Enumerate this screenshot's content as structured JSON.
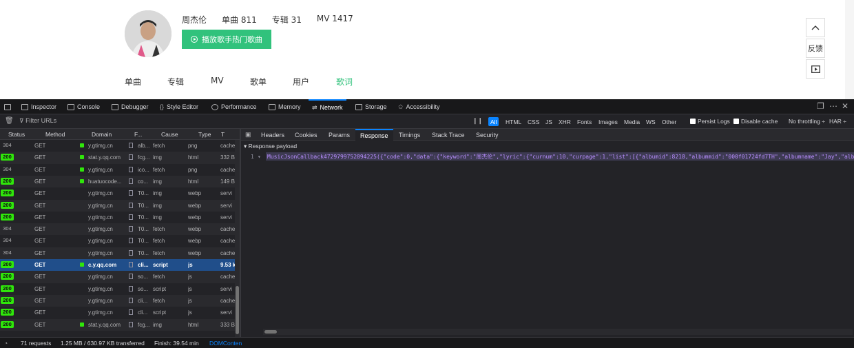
{
  "page": {
    "artist_name": "周杰伦",
    "stats": [
      "单曲 811",
      "专辑 31",
      "MV 1417"
    ],
    "play_button": "播放歌手热门歌曲",
    "tabs": [
      "单曲",
      "专辑",
      "MV",
      "歌单",
      "用户",
      "歌词"
    ],
    "active_tab": "歌词",
    "feedback_label": "反馈",
    "accent_color": "#31c27c"
  },
  "devtools": {
    "tabs": [
      "Inspector",
      "Console",
      "Debugger",
      "Style Editor",
      "Performance",
      "Memory",
      "Network",
      "Storage",
      "Accessibility"
    ],
    "active_tab": "Network",
    "filter_placeholder": "Filter URLs",
    "type_filters": [
      "All",
      "HTML",
      "CSS",
      "JS",
      "XHR",
      "Fonts",
      "Images",
      "Media",
      "WS",
      "Other"
    ],
    "persist_logs": "Persist Logs",
    "disable_cache": "Disable cache",
    "throttling": "No throttling ÷",
    "har": "HAR ÷",
    "columns": [
      "Status",
      "Method",
      "Domain",
      "F...",
      "Cause",
      "Type",
      "T"
    ],
    "requests": [
      {
        "status": "304",
        "method": "GET",
        "domain": "y.gtimg.cn",
        "file": "alb...",
        "cause": "fetch",
        "type": "png",
        "transferred": "cache"
      },
      {
        "status": "200",
        "method": "GET",
        "domain": "stat.y.qq.com",
        "file": "fcg...",
        "cause": "img",
        "type": "html",
        "transferred": "332 B"
      },
      {
        "status": "304",
        "method": "GET",
        "domain": "y.gtimg.cn",
        "file": "ico...",
        "cause": "fetch",
        "type": "png",
        "transferred": "cache"
      },
      {
        "status": "200",
        "method": "GET",
        "domain": "huatuocode...",
        "file": "co...",
        "cause": "img",
        "type": "html",
        "transferred": "149 B"
      },
      {
        "status": "200",
        "method": "GET",
        "domain": "y.gtimg.cn",
        "file": "T0...",
        "cause": "img",
        "type": "webp",
        "transferred": "servi"
      },
      {
        "status": "200",
        "method": "GET",
        "domain": "y.gtimg.cn",
        "file": "T0...",
        "cause": "img",
        "type": "webp",
        "transferred": "servi"
      },
      {
        "status": "200",
        "method": "GET",
        "domain": "y.gtimg.cn",
        "file": "T0...",
        "cause": "img",
        "type": "webp",
        "transferred": "servi"
      },
      {
        "status": "304",
        "method": "GET",
        "domain": "y.gtimg.cn",
        "file": "T0...",
        "cause": "fetch",
        "type": "webp",
        "transferred": "cache"
      },
      {
        "status": "304",
        "method": "GET",
        "domain": "y.gtimg.cn",
        "file": "T0...",
        "cause": "fetch",
        "type": "webp",
        "transferred": "cache"
      },
      {
        "status": "304",
        "method": "GET",
        "domain": "y.gtimg.cn",
        "file": "T0...",
        "cause": "fetch",
        "type": "webp",
        "transferred": "cache"
      },
      {
        "status": "200",
        "method": "GET",
        "domain": "c.y.qq.com",
        "file": "cli...",
        "cause": "script",
        "type": "js",
        "transferred": "9.53 k"
      },
      {
        "status": "200",
        "method": "GET",
        "domain": "y.gtimg.cn",
        "file": "so...",
        "cause": "fetch",
        "type": "js",
        "transferred": "cache"
      },
      {
        "status": "200",
        "method": "GET",
        "domain": "y.gtimg.cn",
        "file": "so...",
        "cause": "script",
        "type": "js",
        "transferred": "servi"
      },
      {
        "status": "200",
        "method": "GET",
        "domain": "y.gtimg.cn",
        "file": "cli...",
        "cause": "fetch",
        "type": "js",
        "transferred": "cache"
      },
      {
        "status": "200",
        "method": "GET",
        "domain": "y.gtimg.cn",
        "file": "cli...",
        "cause": "script",
        "type": "js",
        "transferred": "servi"
      },
      {
        "status": "200",
        "method": "GET",
        "domain": "stat.y.qq.com",
        "file": "fcg...",
        "cause": "img",
        "type": "html",
        "transferred": "333 B"
      }
    ],
    "selected_request": 10,
    "response_tabs": [
      "Headers",
      "Cookies",
      "Params",
      "Response",
      "Timings",
      "Stack Trace",
      "Security"
    ],
    "active_response_tab": "Response",
    "payload_label": "Response payload",
    "line_number": "1",
    "response_code": "MusicJsonCallback4729799752894225({\"code\":0,\"data\":{\"keyword\":\"周杰伦\",\"lyric\":{\"curnum\":10,\"curpage\":1,\"list\":[{\"albumid\":8218,\"albummid\":\"000f01724fd7TH\",\"albumname\":\"Jay\",\"albu",
    "status": {
      "requests": "71 requests",
      "size": "1.25 MB / 630.97 KB transferred",
      "finish": "Finish: 39.54 min",
      "dom": "DOMConten"
    }
  }
}
